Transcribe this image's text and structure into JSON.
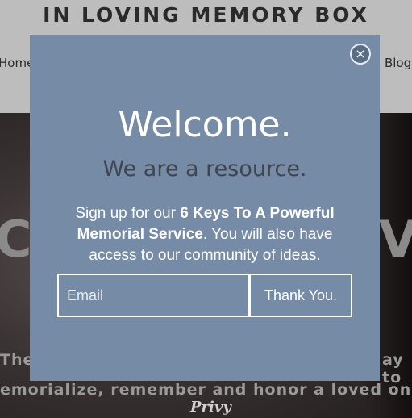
{
  "site": {
    "title": "IN LOVING MEMORY BOX",
    "nav": {
      "home": "Home",
      "blog": "Blog"
    },
    "hero": {
      "word_left": "C",
      "word_right": "V",
      "line1_left": "The",
      "line1_right": "ay to",
      "line2": "emorialize, remember and honor a loved on"
    }
  },
  "popup": {
    "title": "Welcome.",
    "subtitle": "We are a resource.",
    "body_prefix": "Sign up for our ",
    "body_bold": "6 Keys To A Powerful Memorial Service",
    "body_suffix": ". You will also have access to our community of ideas.",
    "email_placeholder": "Email",
    "submit_label": "Thank You.",
    "close_glyph": "×",
    "background_color": "#768ba6"
  },
  "branding": {
    "logo_text": "Privy"
  }
}
